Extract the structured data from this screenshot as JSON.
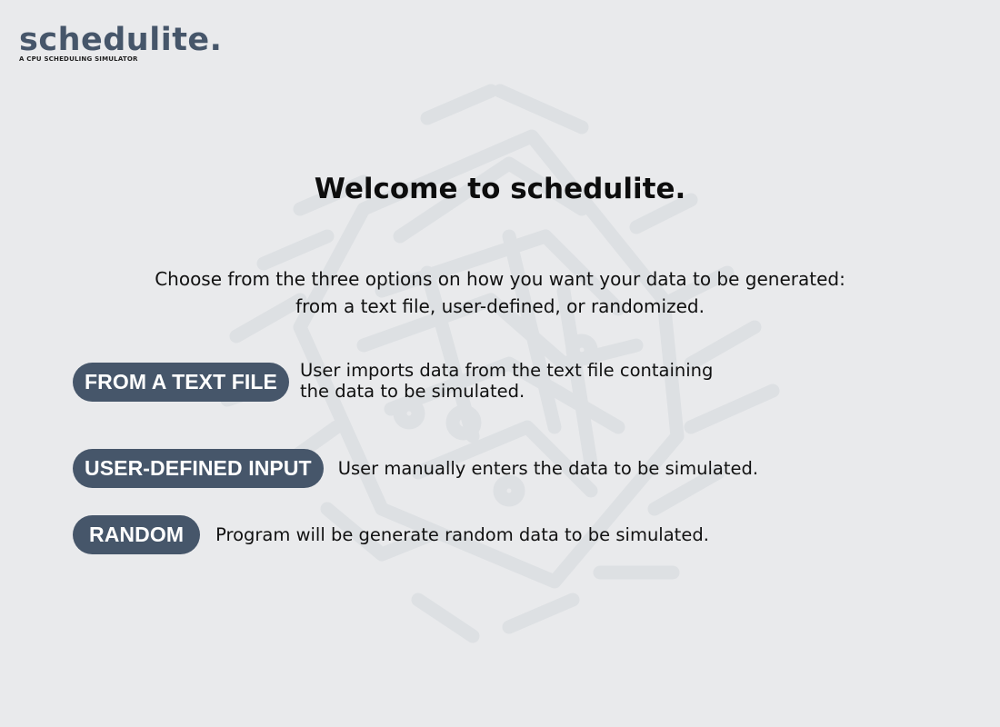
{
  "brand": {
    "logo": "schedulite.",
    "tagline": "A CPU SCHEDULING SIMULATOR"
  },
  "main": {
    "title": "Welcome to schedulite.",
    "intro_line1": "Choose from the three options on how you want your data to be generated:",
    "intro_line2": "from a text file, user-defined, or randomized."
  },
  "options": [
    {
      "label": "FROM A TEXT FILE",
      "description_line1": "User imports data from the text file containing",
      "description_line2": "the data to be simulated."
    },
    {
      "label": "USER-DEFINED INPUT",
      "description": "User manually enters the data to be simulated."
    },
    {
      "label": "RANDOM",
      "description": "Program will be generate random data to be simulated."
    }
  ],
  "colors": {
    "background": "#e9eaec",
    "accent": "#46566a",
    "button_text": "#ffffff",
    "text": "#111111",
    "circuit_art": "#dfe1e4"
  },
  "icons": {
    "background_art": "cpu-circuit-icon"
  }
}
